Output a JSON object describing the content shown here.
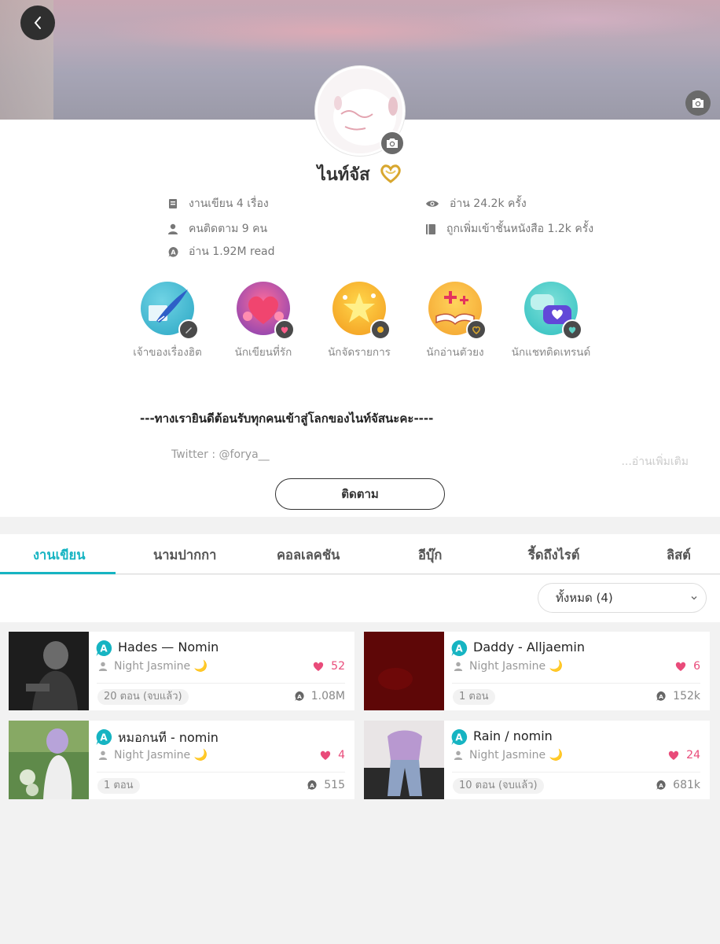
{
  "profile": {
    "name": "ไนท์จัส",
    "stats": {
      "works": "งานเขียน 4 เรื่อง",
      "followers": "คนติดตาม 9 คน",
      "reads_total": "อ่าน 1.92M read",
      "views": "อ่าน 24.2k ครั้ง",
      "shelf": "ถูกเพิ่มเข้าชั้นหนังสือ 1.2k ครั้ง"
    },
    "badges": [
      {
        "label": "เจ้าของเรื่องฮิต",
        "icon": "quill-icon"
      },
      {
        "label": "นักเขียนที่รัก",
        "icon": "heart-icon"
      },
      {
        "label": "นักจัดรายการ",
        "icon": "stars-icon"
      },
      {
        "label": "นักอ่านตัวยง",
        "icon": "book-icon"
      },
      {
        "label": "นักแชทติดเทรนด์",
        "icon": "chat-icon"
      }
    ],
    "bio": "---ทางเรายินดีต้อนรับทุกคนเข้าสู่โลกของไนท์จัสนะคะ----",
    "twitter": "Twitter : @forya__",
    "read_more": "...อ่านเพิ่มเติม",
    "follow_label": "ติดตาม"
  },
  "tabs": [
    "งานเขียน",
    "นามปากกา",
    "คอลเลคชัน",
    "อีบุ๊ก",
    "รี้ดถึงไรต์",
    "ลิสต์"
  ],
  "active_tab": "งานเขียน",
  "filter": {
    "selected": "ทั้งหมด (4)"
  },
  "stories": [
    {
      "title": "Hades — Nomin",
      "author": "Night Jasmine 🌙",
      "likes": "52",
      "chapters": "20 ตอน (จบแล้ว)",
      "reads": "1.08M"
    },
    {
      "title": "Daddy - Alljaemin",
      "author": "Night Jasmine 🌙",
      "likes": "6",
      "chapters": "1 ตอน",
      "reads": "152k"
    },
    {
      "title": "หมอกนที - nomin",
      "author": "Night Jasmine 🌙",
      "likes": "4",
      "chapters": "1 ตอน",
      "reads": "515"
    },
    {
      "title": "Rain / nomin",
      "author": "Night Jasmine 🌙",
      "likes": "24",
      "chapters": "10 ตอน (จบแล้ว)",
      "reads": "681k"
    }
  ],
  "colors": {
    "accent": "#16b4c2",
    "like": "#e94b7a"
  }
}
